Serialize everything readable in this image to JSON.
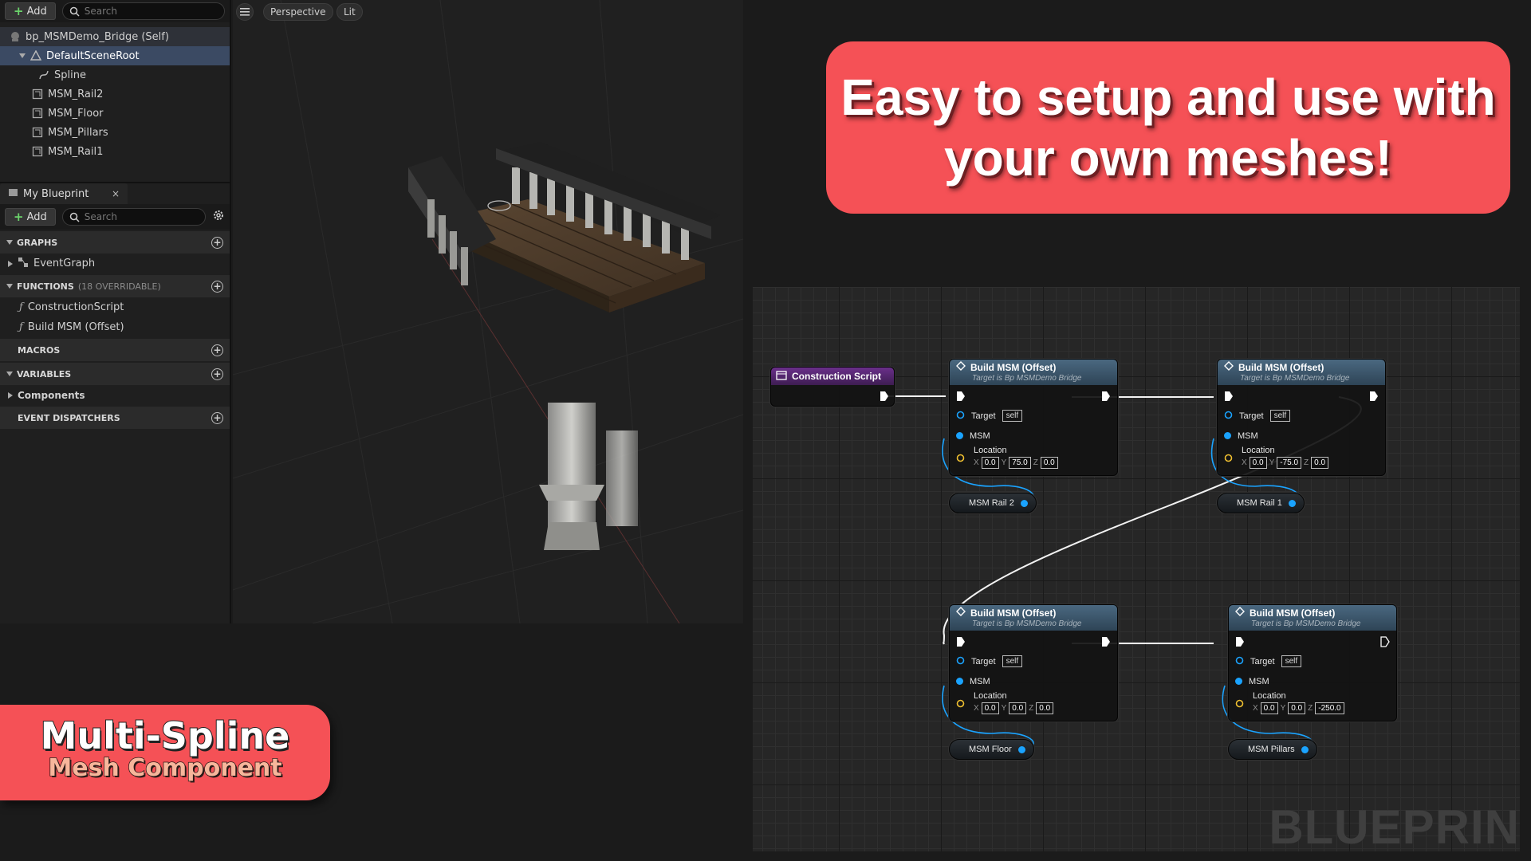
{
  "components": {
    "add_label": "Add",
    "search_placeholder": "Search",
    "tree": [
      {
        "label": "bp_MSMDemo_Bridge (Self)"
      },
      {
        "label": "DefaultSceneRoot"
      },
      {
        "label": "Spline"
      },
      {
        "label": "MSM_Rail2"
      },
      {
        "label": "MSM_Floor"
      },
      {
        "label": "MSM_Pillars"
      },
      {
        "label": "MSM_Rail1"
      }
    ]
  },
  "my_blueprint": {
    "tab_label": "My Blueprint",
    "tab_close": "×",
    "add_label": "Add",
    "search_placeholder": "Search",
    "sections": {
      "graphs": "GRAPHS",
      "functions": "FUNCTIONS",
      "functions_sub": "(18 OVERRIDABLE)",
      "macros": "MACROS",
      "variables": "VARIABLES",
      "event_dispatchers": "EVENT DISPATCHERS"
    },
    "graphs_items": [
      "EventGraph"
    ],
    "functions_items": [
      "ConstructionScript",
      "Build MSM (Offset)"
    ],
    "variables_items": [
      "Components"
    ]
  },
  "viewport": {
    "view_mode": "Perspective",
    "lighting": "Lit"
  },
  "graph": {
    "construction_script": "Construction Script",
    "node_title": "Build MSM (Offset)",
    "node_subtitle": "Target is Bp MSMDemo Bridge",
    "target_label": "Target",
    "self_label": "self",
    "msm_label": "MSM",
    "location_label": "Location",
    "axis_x": "X",
    "axis_y": "Y",
    "axis_z": "Z",
    "nodes": [
      {
        "x": "0.0",
        "y": "75.0",
        "z": "0.0",
        "var": "MSM Rail 2"
      },
      {
        "x": "0.0",
        "y": "-75.0",
        "z": "0.0",
        "var": "MSM Rail 1"
      },
      {
        "x": "0.0",
        "y": "0.0",
        "z": "0.0",
        "var": "MSM Floor"
      },
      {
        "x": "0.0",
        "y": "0.0",
        "z": "-250.0",
        "var": "MSM Pillars"
      }
    ],
    "watermark": "BLUEPRIN"
  },
  "promo": {
    "headline_line1": "Easy to setup and use with",
    "headline_line2": "your own meshes!",
    "product_line1": "Multi-Spline",
    "product_line2": "Mesh Component"
  },
  "colors": {
    "banner": "#f55156",
    "node_header": "#3b566b",
    "construction_header": "#5a2878",
    "object_pin": "#1aa3ff",
    "vector_pin": "#f0c030"
  }
}
